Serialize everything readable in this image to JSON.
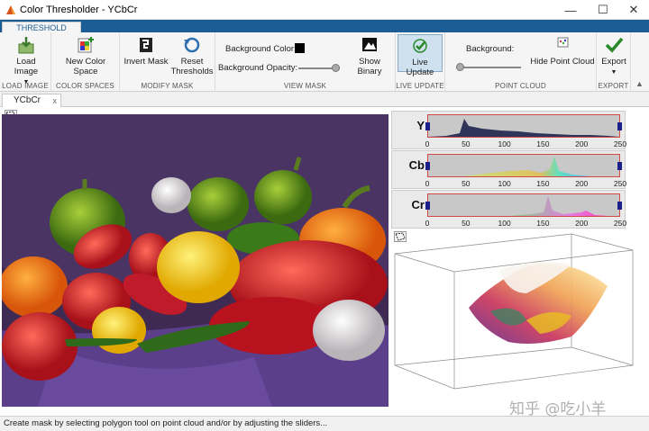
{
  "window": {
    "title": "Color Thresholder - YCbCr",
    "minimize": "—",
    "maximize": "☐",
    "close": "✕"
  },
  "ribbon_tab": "THRESHOLD",
  "groups": {
    "load_image": {
      "label": "LOAD IMAGE",
      "button": "Load Image"
    },
    "color_spaces": {
      "label": "COLOR SPACES",
      "button": "New Color Space"
    },
    "modify_mask": {
      "label": "MODIFY MASK",
      "invert": "Invert Mask",
      "reset": "Reset Thresholds"
    },
    "view_mask": {
      "label": "VIEW MASK",
      "bg_color": "Background Color:",
      "bg_opacity": "Background Opacity:",
      "opacity_value": 0.9,
      "show_binary": "Show Binary"
    },
    "live_update": {
      "label": "LIVE UPDATE",
      "button": "Live Update"
    },
    "point_cloud": {
      "label": "POINT CLOUD",
      "background": "Background:",
      "bg_value": 0.05,
      "hide": "Hide Point Cloud"
    },
    "export": {
      "label": "EXPORT",
      "button": "Export"
    }
  },
  "document_tab": {
    "label": "YCbCr",
    "close": "x"
  },
  "histograms": [
    {
      "channel": "Y",
      "ticks": [
        "0",
        "50",
        "100",
        "150",
        "200",
        "250"
      ]
    },
    {
      "channel": "Cb",
      "ticks": [
        "0",
        "50",
        "100",
        "150",
        "200",
        "250"
      ]
    },
    {
      "channel": "Cr",
      "ticks": [
        "0",
        "50",
        "100",
        "150",
        "200",
        "250"
      ]
    }
  ],
  "status": "Create mask by selecting polygon tool on point cloud and/or by adjusting the sliders...",
  "watermark": "知乎 @吃小羊",
  "colors": {
    "accent": "#1d5d95",
    "live_update_active": "#cfe0ee"
  },
  "icons": [
    "app-icon",
    "load-image-icon",
    "new-color-space-icon",
    "invert-mask-icon",
    "reset-thresholds-icon",
    "background-color-swatch",
    "show-binary-icon",
    "live-update-icon",
    "hide-point-cloud-icon",
    "export-icon",
    "polygon-tool-icon"
  ]
}
